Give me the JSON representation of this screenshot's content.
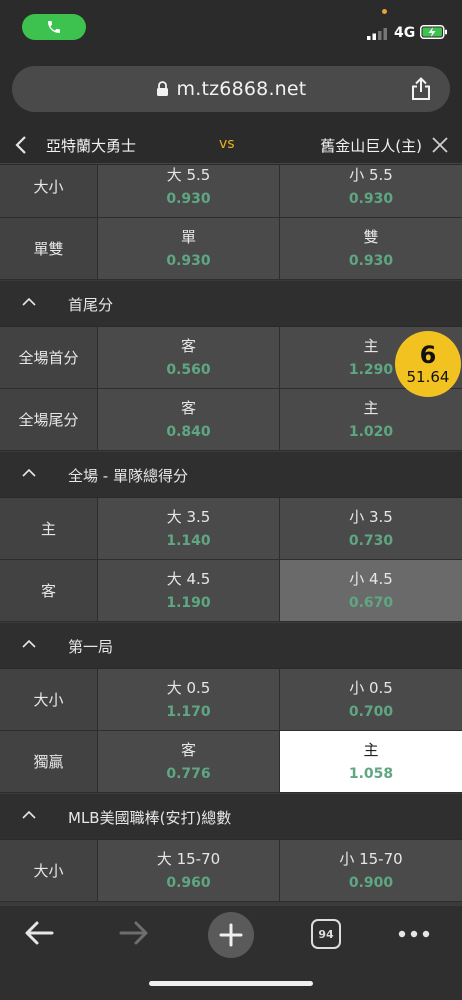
{
  "status_bar": {
    "network": "4G"
  },
  "browser": {
    "url": "m.tz6868.net",
    "tab_count": "94"
  },
  "match": {
    "away_team": "亞特蘭大勇士",
    "vs": "vs",
    "home_team": "舊金山巨人(主)"
  },
  "rows_top": [
    {
      "label": "大小",
      "left_opt": "大 5.5",
      "left_odds": "0.930",
      "right_opt": "小 5.5",
      "right_odds": "0.930"
    },
    {
      "label": "單雙",
      "left_opt": "單",
      "left_odds": "0.930",
      "right_opt": "雙",
      "right_odds": "0.930"
    }
  ],
  "sections": [
    {
      "title": "首尾分",
      "rows": [
        {
          "label": "全場首分",
          "left_opt": "客",
          "left_odds": "0.560",
          "right_opt": "主",
          "right_odds": "1.290"
        },
        {
          "label": "全場尾分",
          "left_opt": "客",
          "left_odds": "0.840",
          "right_opt": "主",
          "right_odds": "1.020"
        }
      ]
    },
    {
      "title": "全場 - 單隊總得分",
      "rows": [
        {
          "label": "主",
          "left_opt": "大 3.5",
          "left_odds": "1.140",
          "right_opt": "小 3.5",
          "right_odds": "0.730"
        },
        {
          "label": "客",
          "left_opt": "大 4.5",
          "left_odds": "1.190",
          "right_opt": "小 4.5",
          "right_odds": "0.670"
        }
      ]
    },
    {
      "title": "第一局",
      "rows": [
        {
          "label": "大小",
          "left_opt": "大 0.5",
          "left_odds": "1.170",
          "right_opt": "小 0.5",
          "right_odds": "0.700"
        },
        {
          "label": "獨贏",
          "left_opt": "客",
          "left_odds": "0.776",
          "right_opt": "主",
          "right_odds": "1.058"
        }
      ]
    },
    {
      "title": "MLB美國職棒(安打)總數",
      "rows": [
        {
          "label": "大小",
          "left_opt": "大 15-70",
          "left_odds": "0.960",
          "right_opt": "小 15-70",
          "right_odds": "0.900"
        }
      ]
    }
  ],
  "bet_slip_badge": {
    "count": "6",
    "amount": "51.64"
  },
  "colors": {
    "odds_green": "#5fa782",
    "vs_yellow": "#e8b41c",
    "badge_yellow": "#f2c220",
    "call_green": "#3dc24f"
  }
}
